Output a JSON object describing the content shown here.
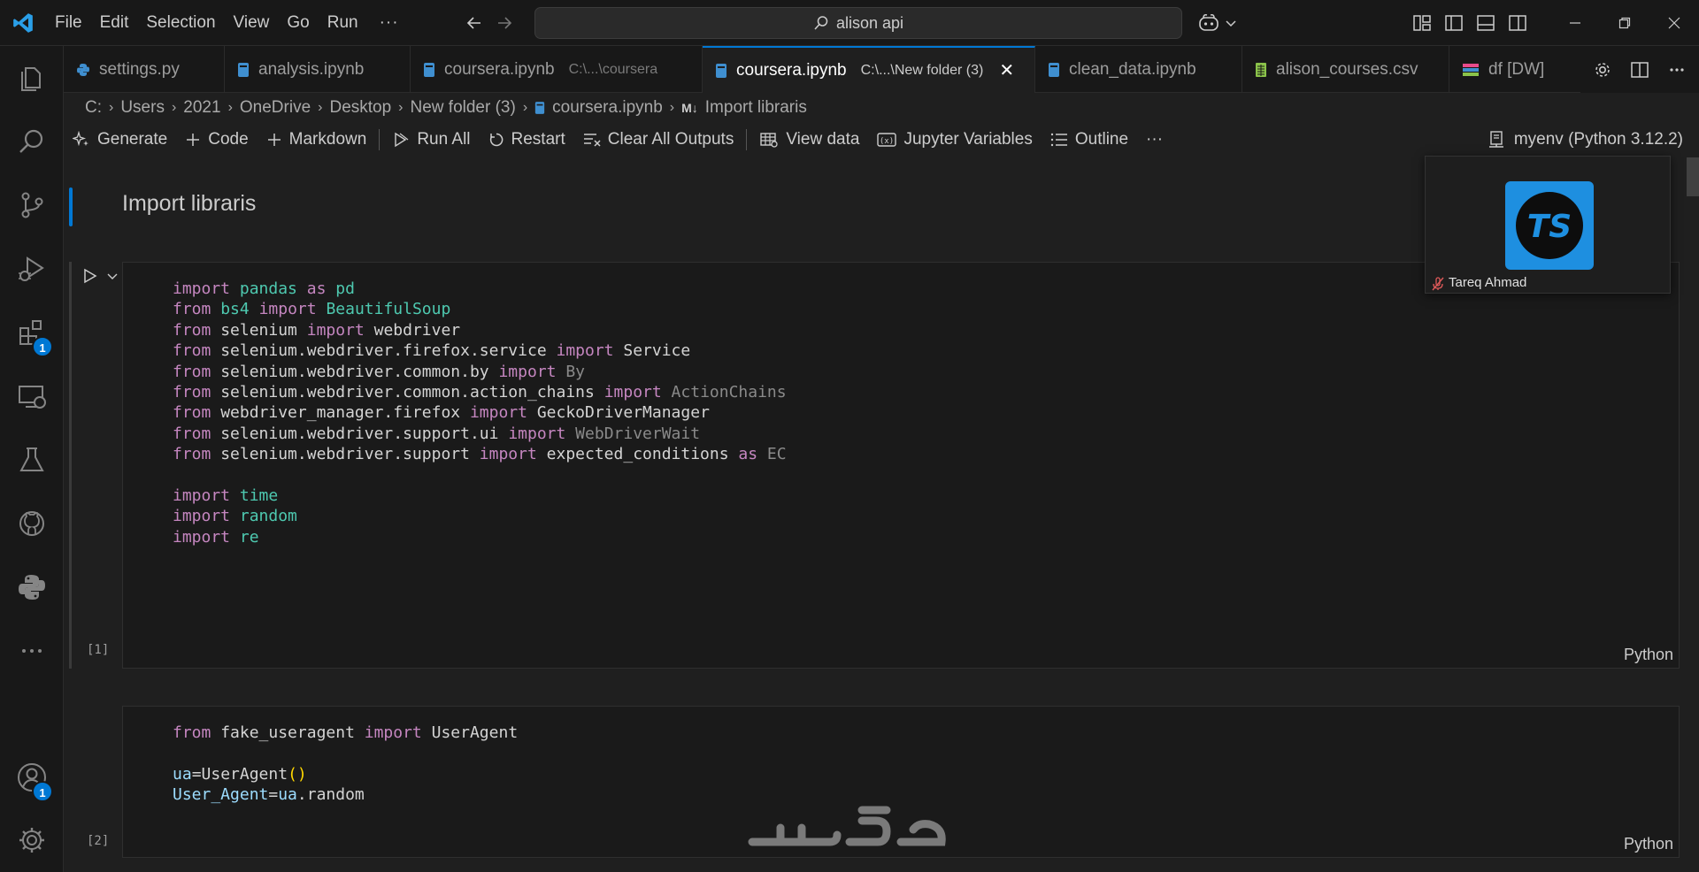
{
  "titlebar": {
    "menu": [
      "File",
      "Edit",
      "Selection",
      "View",
      "Go",
      "Run"
    ],
    "more": "···",
    "search_text": "alison api"
  },
  "tabs": [
    {
      "label": "settings.py",
      "desc": "",
      "icon": "python-icon"
    },
    {
      "label": "analysis.ipynb",
      "desc": "",
      "icon": "notebook-icon"
    },
    {
      "label": "coursera.ipynb",
      "desc": "C:\\...\\coursera",
      "icon": "notebook-icon"
    },
    {
      "label": "coursera.ipynb",
      "desc": "C:\\...\\New folder (3)",
      "icon": "notebook-icon",
      "active": true
    },
    {
      "label": "clean_data.ipynb",
      "desc": "",
      "icon": "notebook-icon"
    },
    {
      "label": "alison_courses.csv",
      "desc": "",
      "icon": "csv-icon"
    },
    {
      "label": "df [DW]",
      "desc": "",
      "icon": "data-wrangler-icon"
    }
  ],
  "breadcrumb": {
    "items": [
      "C:",
      "Users",
      "2021",
      "OneDrive",
      "Desktop",
      "New folder (3)",
      "coursera.ipynb",
      "Import libraris"
    ],
    "md_marker": "M↓"
  },
  "toolbar": {
    "generate": "Generate",
    "code": "Code",
    "markdown": "Markdown",
    "run_all": "Run All",
    "restart": "Restart",
    "clear_outputs": "Clear All Outputs",
    "view_data": "View data",
    "jupyter_variables": "Jupyter Variables",
    "outline": "Outline",
    "more": "···",
    "kernel": "myenv (Python 3.12.2)"
  },
  "cells": {
    "markdown_text": "Import libraris",
    "cell1_count": "[1]",
    "cell2_count": "[2]",
    "language": "Python",
    "cell1_lines": [
      [
        [
          "kw",
          "import"
        ],
        [
          "fn",
          " "
        ],
        [
          "mod",
          "pandas"
        ],
        [
          "fn",
          " "
        ],
        [
          "kw",
          "as"
        ],
        [
          "fn",
          " "
        ],
        [
          "mod",
          "pd"
        ]
      ],
      [
        [
          "kw",
          "from"
        ],
        [
          "fn",
          " "
        ],
        [
          "mod",
          "bs4"
        ],
        [
          "fn",
          " "
        ],
        [
          "kw",
          "import"
        ],
        [
          "fn",
          " "
        ],
        [
          "mod",
          "BeautifulSoup"
        ]
      ],
      [
        [
          "kw",
          "from"
        ],
        [
          "fn",
          " selenium "
        ],
        [
          "kw",
          "import"
        ],
        [
          "fn",
          " webdriver"
        ]
      ],
      [
        [
          "kw",
          "from"
        ],
        [
          "fn",
          " selenium.webdriver.firefox.service "
        ],
        [
          "kw",
          "import"
        ],
        [
          "fn",
          " Service"
        ]
      ],
      [
        [
          "kw",
          "from"
        ],
        [
          "fn",
          " selenium.webdriver.common.by "
        ],
        [
          "kw",
          "import"
        ],
        [
          "dim",
          " By"
        ]
      ],
      [
        [
          "kw",
          "from"
        ],
        [
          "fn",
          " selenium.webdriver.common.action_chains "
        ],
        [
          "kw",
          "import"
        ],
        [
          "dim",
          " ActionChains"
        ]
      ],
      [
        [
          "kw",
          "from"
        ],
        [
          "fn",
          " webdriver_manager.firefox "
        ],
        [
          "kw",
          "import"
        ],
        [
          "fn",
          " GeckoDriverManager"
        ]
      ],
      [
        [
          "kw",
          "from"
        ],
        [
          "fn",
          " selenium.webdriver.support.ui "
        ],
        [
          "kw",
          "import"
        ],
        [
          "dim",
          " WebDriverWait"
        ]
      ],
      [
        [
          "kw",
          "from"
        ],
        [
          "fn",
          " selenium.webdriver.support "
        ],
        [
          "kw",
          "import"
        ],
        [
          "fn",
          " expected_conditions "
        ],
        [
          "kw",
          "as"
        ],
        [
          "dim",
          " EC"
        ]
      ],
      [],
      [
        [
          "kw",
          "import"
        ],
        [
          "mod",
          " time"
        ]
      ],
      [
        [
          "kw",
          "import"
        ],
        [
          "mod",
          " random"
        ]
      ],
      [
        [
          "kw",
          "import"
        ],
        [
          "mod",
          " re"
        ]
      ]
    ],
    "cell2_lines": [
      [
        [
          "kw",
          "from"
        ],
        [
          "fn",
          " fake_useragent "
        ],
        [
          "kw",
          "import"
        ],
        [
          "fn",
          " UserAgent"
        ]
      ],
      [],
      [
        [
          "var",
          "ua"
        ],
        [
          "fn",
          "=UserAgent"
        ],
        [
          "paren",
          "()"
        ]
      ],
      [
        [
          "var",
          "User_Agent"
        ],
        [
          "fn",
          "="
        ],
        [
          "var",
          "ua"
        ],
        [
          "fn",
          ".random"
        ]
      ]
    ]
  },
  "overlay": {
    "participant_name": "Tareq Ahmad",
    "avatar_initials": "TS"
  },
  "colors": {
    "accent": "#0078d4",
    "keyword": "#c586c0",
    "module": "#4ec9b0",
    "variable": "#9cdcfe"
  }
}
